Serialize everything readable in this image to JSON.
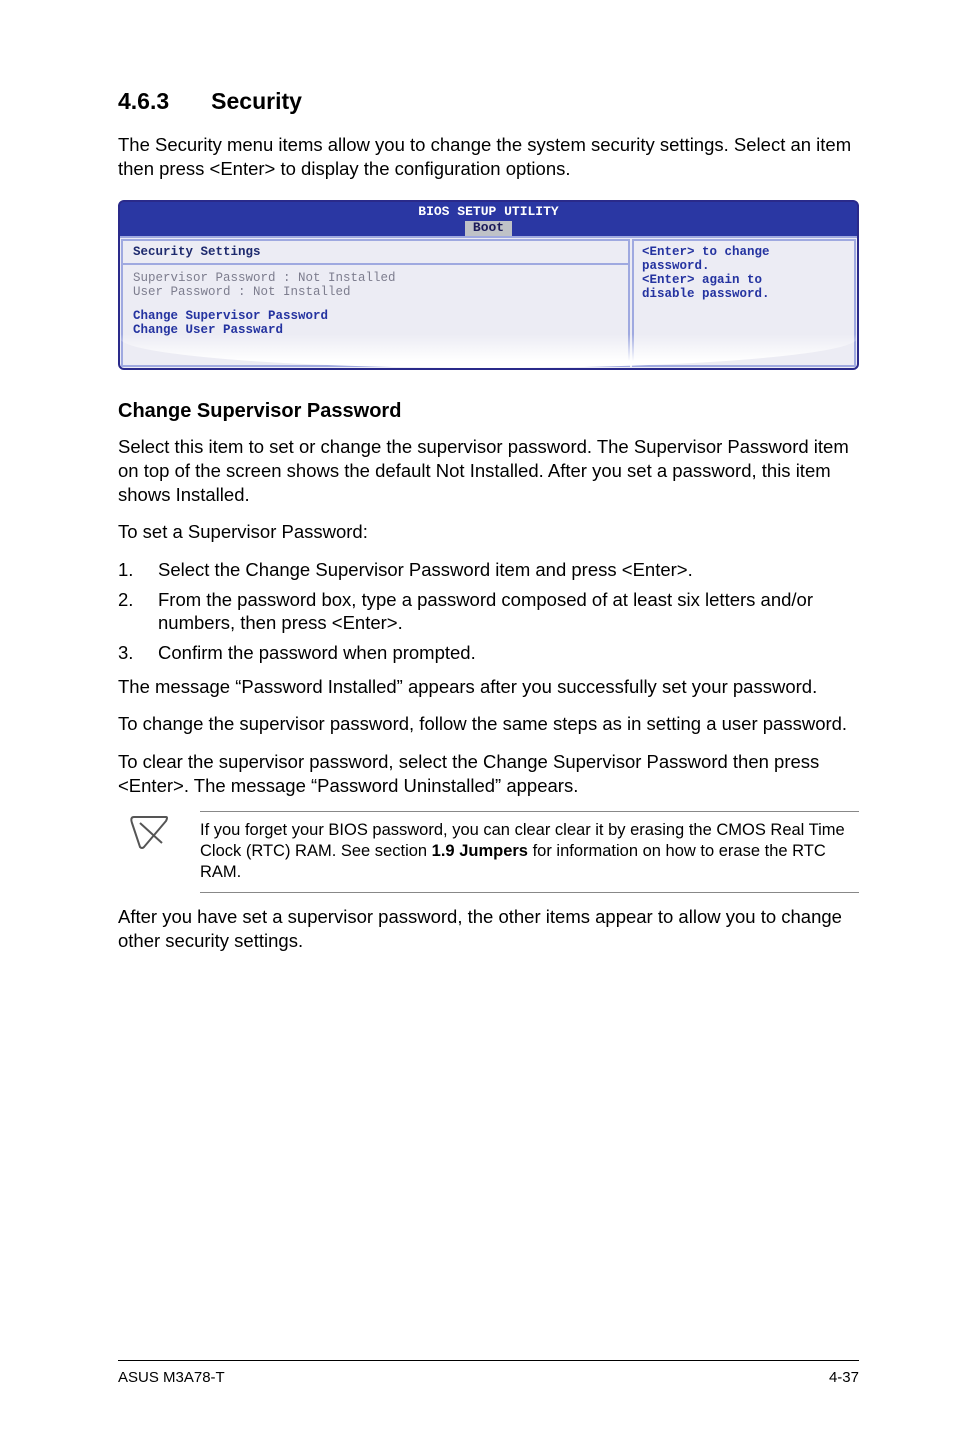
{
  "heading": {
    "number": "4.6.3",
    "title": "Security"
  },
  "intro": "The Security menu items allow you to change the system security settings. Select an item then press <Enter> to display the configuration options.",
  "bios": {
    "header_line1": "BIOS SETUP UTILITY",
    "header_tab": "Boot",
    "left": {
      "title": "Security Settings",
      "row1_label": "Supervisor Password",
      "row1_sep": "  : ",
      "row1_value": "Not Installed",
      "row2_label": "User Password",
      "row2_sep": "        : ",
      "row2_value": "Not Installed",
      "row3": "Change Supervisor Password",
      "row4": "Change User Passward"
    },
    "right": {
      "line1": "<Enter> to change",
      "line2": "password.",
      "line3": "<Enter> again to",
      "line4": "disable password."
    }
  },
  "subheading": "Change Supervisor Password",
  "para1": "Select this item to set or change the supervisor password. The Supervisor Password item on top of the screen shows the default Not Installed. After you set a password, this item shows Installed.",
  "para2": "To set a Supervisor Password:",
  "steps": {
    "s1": "Select the Change Supervisor Password item and press <Enter>.",
    "s2": "From the password box, type a password composed of at least six letters and/or numbers, then press <Enter>.",
    "s3": "Confirm the password when prompted."
  },
  "para3": "The message “Password Installed” appears after you successfully set your password.",
  "para4": "To change the supervisor password, follow the same steps as in setting a user password.",
  "para5": "To clear the supervisor password, select the Change Supervisor Password then press <Enter>. The message “Password Uninstalled” appears.",
  "note": {
    "pre": "If you forget your BIOS password, you can clear clear it by erasing the CMOS Real Time Clock (RTC) RAM. See section ",
    "bold": "1.9 Jumpers",
    "post": " for information on how to erase the RTC RAM."
  },
  "para6": "After you have set a supervisor password, the other items appear to allow you to change other security settings.",
  "footer": {
    "left": "ASUS M3A78-T",
    "right": "4-37"
  }
}
